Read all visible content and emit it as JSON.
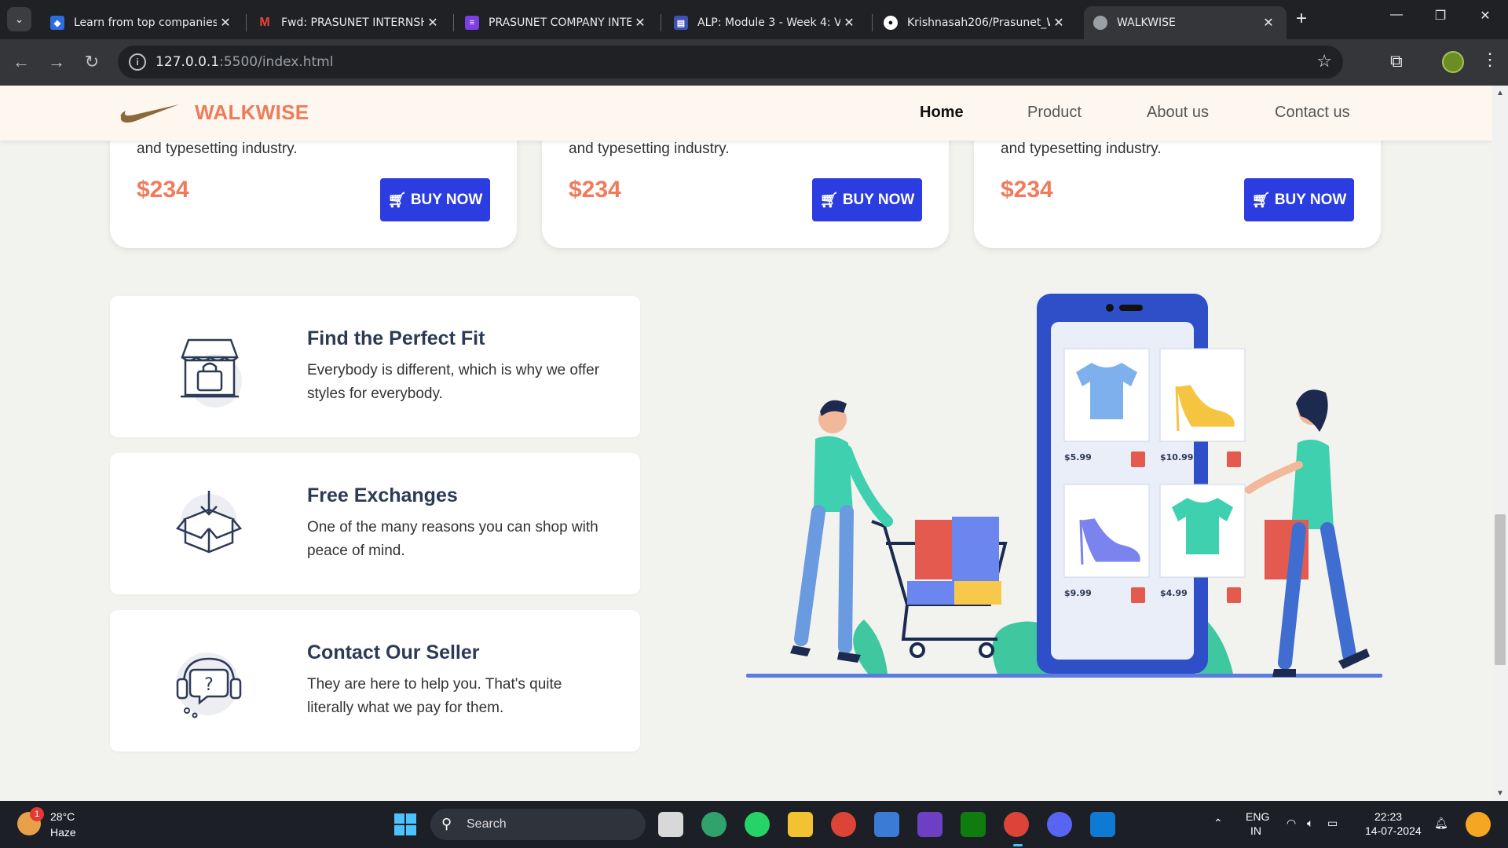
{
  "browser": {
    "tabs": [
      {
        "title": "Learn from top companies",
        "favicon_color": "#2d6cdf"
      },
      {
        "title": "Fwd: PRASUNET INTERNSH",
        "favicon_color": "#ea4335"
      },
      {
        "title": "PRASUNET COMPANY INTE",
        "favicon_color": "#7b3fe4"
      },
      {
        "title": "ALP: Module 3 - Week 4: V",
        "favicon_color": "#3f51b5"
      },
      {
        "title": "Krishnasah206/Prasunet_W",
        "favicon_color": "#ffffff"
      },
      {
        "title": "WALKWISE",
        "favicon_color": "#9aa0a6"
      }
    ],
    "url_host": "127.0.0.1",
    "url_rest": ":5500/index.html"
  },
  "site": {
    "brand": "WALKWISE",
    "nav": [
      "Home",
      "Product",
      "About us",
      "Contact us"
    ],
    "products": [
      {
        "desc": "and typesetting industry.",
        "price": "$234",
        "button": "BUY NOW"
      },
      {
        "desc": "and typesetting industry.",
        "price": "$234",
        "button": "BUY NOW"
      },
      {
        "desc": "and typesetting industry.",
        "price": "$234",
        "button": "BUY NOW"
      }
    ],
    "features": [
      {
        "title": "Find the Perfect Fit",
        "text": "Everybody is different, which is why we offer styles for everybody.",
        "icon": "store-bag-icon"
      },
      {
        "title": "Free Exchanges",
        "text": "One of the many reasons you can shop with peace of mind.",
        "icon": "box-exchange-icon"
      },
      {
        "title": "Contact Our Seller",
        "text": "They are here to help you. That's quite literally what we pay for them.",
        "icon": "headset-support-icon"
      }
    ],
    "illustration_prices": [
      "$5.99",
      "$10.99",
      "$9.99",
      "$4.99"
    ],
    "accent": "#f07a5a",
    "button_color": "#2b3de0"
  },
  "taskbar": {
    "weather_temp": "28°C",
    "weather_cond": "Haze",
    "weather_badge": "1",
    "search_label": "Search",
    "lang_top": "ENG",
    "lang_bottom": "IN",
    "time": "22:23",
    "date": "14-07-2024"
  }
}
